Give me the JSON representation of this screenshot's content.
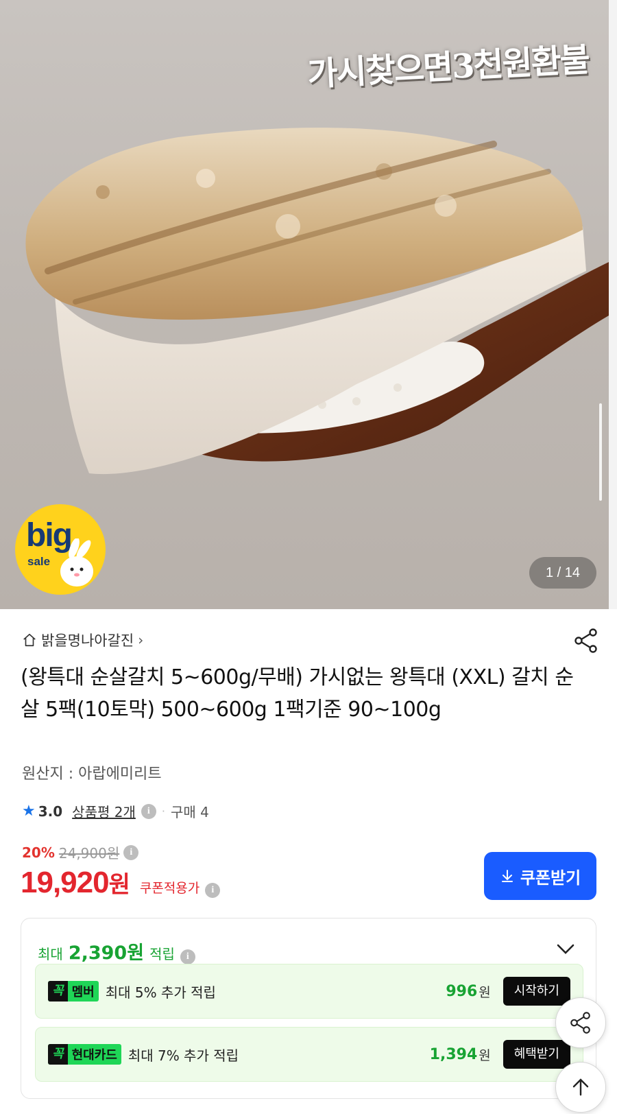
{
  "hero": {
    "caption": "가시찾으면3천원환불",
    "badge_big": "big",
    "badge_sale": "sale",
    "page_counter": "1 / 14"
  },
  "seller": {
    "name": "밝을명나아갈진",
    "chevron": "›"
  },
  "product": {
    "title": "(왕특대 순살갈치 5~600g/무배) 가시없는 왕특대 (XXL) 갈치 순살 5팩(10토막) 500~600g 1팩기준 90~100g",
    "origin": "원산지 : 아랍에미리트"
  },
  "rating": {
    "star": "★",
    "score": "3.0",
    "reviews": "상품평 2개",
    "separator": "·",
    "purchases": "구매 4"
  },
  "price": {
    "discount": "20%",
    "original": "24,900원",
    "current": "19,920",
    "unit": "원",
    "coupon_note": "쿠폰적용가",
    "coupon_button": "쿠폰받기",
    "coupon_icon": "⤓"
  },
  "reward": {
    "prefix": "최대",
    "amount": "2,390원",
    "suffix": "적립",
    "benefits": [
      {
        "tag_k": "꼭",
        "tag": "멤버",
        "desc": "최대 5% 추가 적립",
        "points": "996",
        "won": "원",
        "button": "시작하기"
      },
      {
        "tag_k": "꼭",
        "tag": "현대카드",
        "desc": "최대 7% 추가 적립",
        "points": "1,394",
        "won": "원",
        "button": "혜택받기"
      }
    ]
  },
  "icons": {
    "home": "home-icon",
    "share": "share-icon",
    "info": "info-icon",
    "chevron_down": "chevron-down-icon",
    "arrow_up": "arrow-up-icon"
  },
  "colors": {
    "accent_blue": "#1a5cff",
    "price_red": "#e3262e",
    "reward_green": "#18a333",
    "tag_green": "#1fd657",
    "badge_yellow": "#ffd21c"
  }
}
